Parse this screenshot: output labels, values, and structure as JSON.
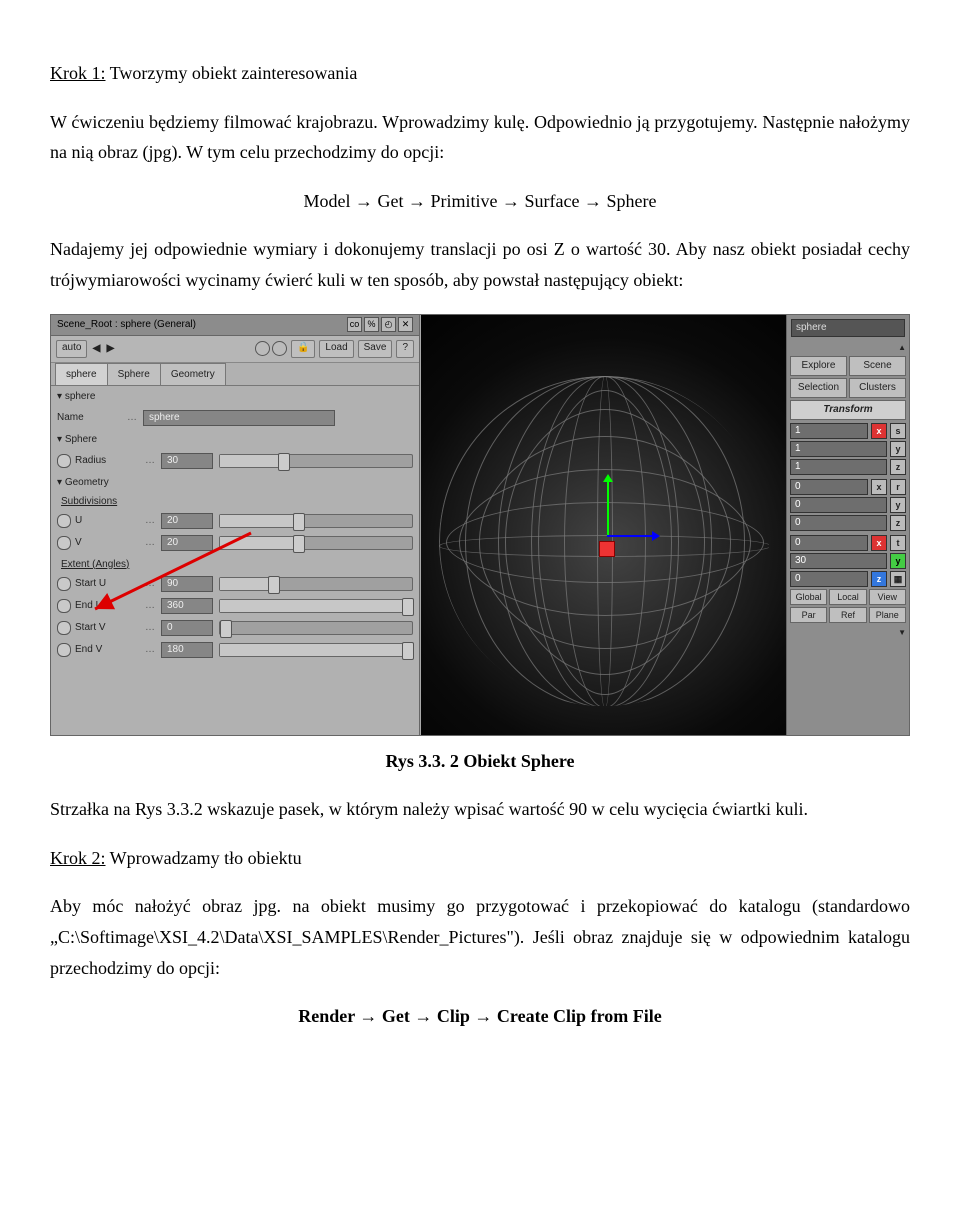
{
  "step1": {
    "heading_prefix": "Krok 1:",
    "heading_rest": " Tworzymy obiekt zainteresowania",
    "para": "W ćwiczeniu będziemy filmować krajobrazu. Wprowadzimy kulę. Odpowiednio ją przygotujemy. Następnie nałożymy na nią obraz (jpg). W tym celu przechodzimy do opcji:",
    "menu_path": "Model → Get → Primitive → Surface → Sphere",
    "para2": "Nadajemy jej odpowiednie wymiary i dokonujemy translacji po osi Z o wartość 30. Aby nasz obiekt posiadał cechy trójwymiarowości wycinamy ćwierć kuli w ten sposób, aby powstał następujący obiekt:"
  },
  "caption": "Rys 3.3. 2 Obiekt Sphere",
  "post_fig": "Strzałka na Rys 3.3.2 wskazuje pasek, w którym należy wpisać wartość 90 w celu wycięcia ćwiartki kuli.",
  "step2": {
    "heading_prefix": "Krok 2:",
    "heading_rest": " Wprowadzamy tło obiektu",
    "para": "Aby móc nałożyć obraz jpg. na obiekt musimy go przygotować i przekopiować do katalogu (standardowo „C:\\Softimage\\XSI_4.2\\Data\\XSI_SAMPLES\\Render_Pictures\"). Jeśli obraz znajduje się w odpowiednim katalogu przechodzimy do opcji:",
    "menu_path": "Render → Get → Clip → Create Clip from File"
  },
  "panel": {
    "title": "Scene_Root : sphere (General)",
    "auto": "auto",
    "toolbar": {
      "lock": "🔒",
      "load": "Load",
      "save": "Save",
      "help": "?"
    },
    "tabs": [
      "sphere",
      "Sphere",
      "Geometry"
    ],
    "node": "sphere",
    "name_label": "Name",
    "name_value": "sphere",
    "group_sphere": "Sphere",
    "radius_label": "Radius",
    "radius_value": "30",
    "group_geometry": "Geometry",
    "sub_subdiv": "Subdivisions",
    "u_label": "U",
    "u_value": "20",
    "v_label": "V",
    "v_value": "20",
    "sub_extent": "Extent (Angles)",
    "startu_label": "Start U",
    "startu_value": "90",
    "endu_label": "End U",
    "endu_value": "360",
    "startv_label": "Start V",
    "startv_value": "0",
    "endv_label": "End V",
    "endv_value": "180"
  },
  "cmd": {
    "search": "sphere",
    "explore": "Explore",
    "scene": "Scene",
    "selection": "Selection",
    "clusters": "Clusters",
    "transform": "Transform",
    "s": {
      "x": "1",
      "y": "1",
      "z": "1"
    },
    "r": {
      "x": "0",
      "y": "0",
      "z": "0"
    },
    "t": {
      "x": "0",
      "y": "30",
      "z": "0"
    },
    "global": "Global",
    "local": "Local",
    "view": "View",
    "par": "Par",
    "ref": "Ref",
    "plane": "Plane"
  }
}
